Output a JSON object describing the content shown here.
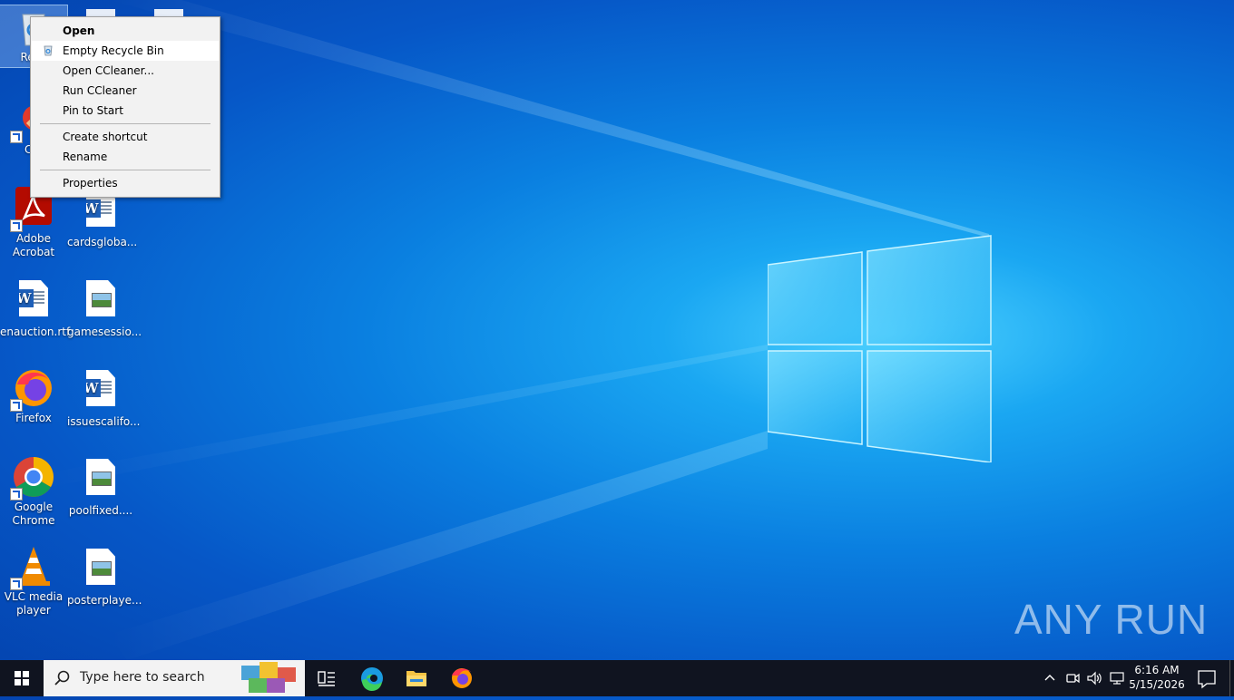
{
  "desktop": {
    "icons": [
      {
        "label": "Recy",
        "kind": "recycle"
      },
      {
        "label": "CCl",
        "kind": "ccleaner"
      },
      {
        "label": "Adobe Acrobat",
        "kind": "acrobat"
      },
      {
        "label": "cardsgloba...",
        "kind": "word"
      },
      {
        "label": "enauction.rtf",
        "kind": "word"
      },
      {
        "label": "gamesessio...",
        "kind": "image"
      },
      {
        "label": "Firefox",
        "kind": "firefox"
      },
      {
        "label": "issuescalifo...",
        "kind": "word"
      },
      {
        "label": "Google Chrome",
        "kind": "chrome"
      },
      {
        "label": "poolfixed....",
        "kind": "image"
      },
      {
        "label": "VLC media player",
        "kind": "vlc"
      },
      {
        "label": "posterplaye...",
        "kind": "image"
      }
    ]
  },
  "context_menu": {
    "items": [
      {
        "label": "Open"
      },
      {
        "label": "Empty Recycle Bin"
      },
      {
        "label": "Open CCleaner..."
      },
      {
        "label": "Run CCleaner"
      },
      {
        "label": "Pin to Start"
      },
      {
        "label": "Create shortcut"
      },
      {
        "label": "Rename"
      },
      {
        "label": "Properties"
      }
    ]
  },
  "watermark": "ANY RUN",
  "taskbar": {
    "search_placeholder": "Type here to search",
    "clock_time": "6:16 AM",
    "clock_date": "5/15/2026"
  },
  "colors": {
    "taskbar": "#101420",
    "menu_bg": "#f2f2f2",
    "accent": "#0a7fe0"
  }
}
